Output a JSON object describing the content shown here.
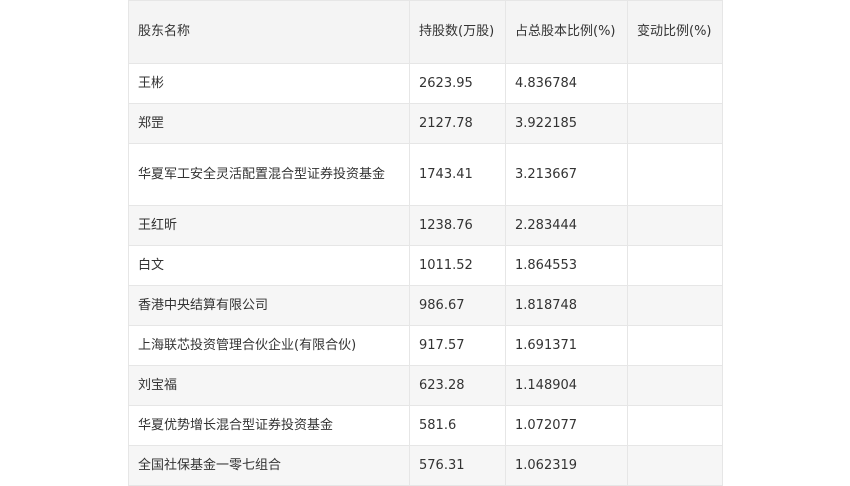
{
  "header": {
    "col_name": "股东名称",
    "col_shares": "持股数(万股)",
    "col_pct": "占总股本比例(%)",
    "col_change": "变动比例(%)"
  },
  "rows": [
    {
      "name": "王彬",
      "shares": "2623.95",
      "pct": "4.836784",
      "change": ""
    },
    {
      "name": "郑罡",
      "shares": "2127.78",
      "pct": "3.922185",
      "change": ""
    },
    {
      "name": "华夏军工安全灵活配置混合型证券投资基金",
      "shares": "1743.41",
      "pct": "3.213667",
      "change": ""
    },
    {
      "name": "王红昕",
      "shares": "1238.76",
      "pct": "2.283444",
      "change": ""
    },
    {
      "name": "白文",
      "shares": "1011.52",
      "pct": "1.864553",
      "change": ""
    },
    {
      "name": "香港中央结算有限公司",
      "shares": "986.67",
      "pct": "1.818748",
      "change": ""
    },
    {
      "name": "上海联芯投资管理合伙企业(有限合伙)",
      "shares": "917.57",
      "pct": "1.691371",
      "change": ""
    },
    {
      "name": "刘宝福",
      "shares": "623.28",
      "pct": "1.148904",
      "change": ""
    },
    {
      "name": "华夏优势增长混合型证券投资基金",
      "shares": "581.6",
      "pct": "1.072077",
      "change": ""
    },
    {
      "name": "全国社保基金一零七组合",
      "shares": "576.31",
      "pct": "1.062319",
      "change": ""
    }
  ]
}
